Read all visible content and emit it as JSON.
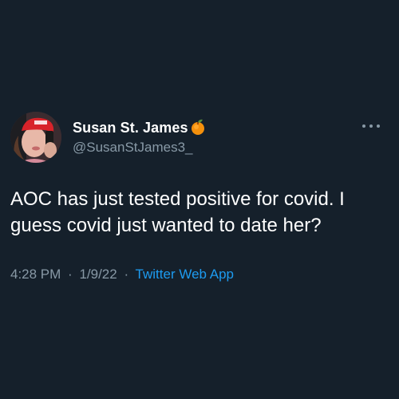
{
  "tweet": {
    "author": {
      "display_name": "Susan St. James",
      "handle": "@SusanStJames3_",
      "name_emoji": "peach-icon"
    },
    "text": "AOC has just tested positive for covid. I\nguess covid just wanted to date her?",
    "time": "4:28 PM",
    "date": "1/9/22",
    "separator": "·",
    "source": "Twitter Web App"
  },
  "colors": {
    "background": "#15202b",
    "text_primary": "#ffffff",
    "text_secondary": "#8899a6",
    "link": "#1d9bf0"
  }
}
